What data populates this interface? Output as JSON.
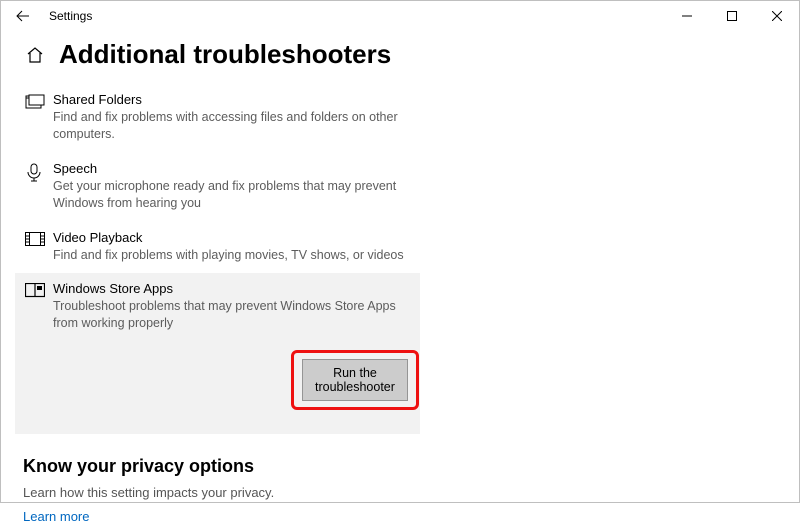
{
  "window": {
    "title": "Settings"
  },
  "page": {
    "title": "Additional troubleshooters"
  },
  "items": [
    {
      "name": "Shared Folders",
      "desc": "Find and fix problems with accessing files and folders on other computers."
    },
    {
      "name": "Speech",
      "desc": "Get your microphone ready and fix problems that may prevent Windows from hearing you"
    },
    {
      "name": "Video Playback",
      "desc": "Find and fix problems with playing movies, TV shows, or videos"
    },
    {
      "name": "Windows Store Apps",
      "desc": "Troubleshoot problems that may prevent Windows Store Apps from working properly",
      "button": "Run the troubleshooter"
    }
  ],
  "privacy": {
    "heading": "Know your privacy options",
    "sub": "Learn how this setting impacts your privacy.",
    "link": "Learn more"
  }
}
